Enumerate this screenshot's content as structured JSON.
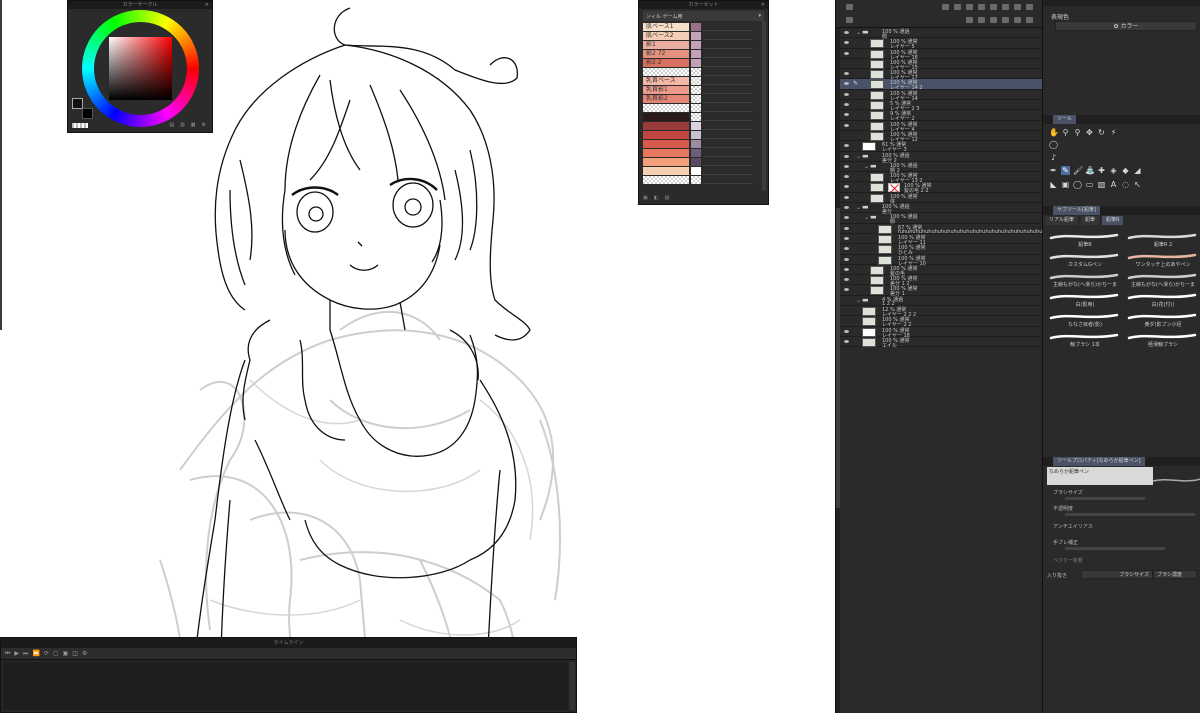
{
  "color_wheel_panel": {
    "title": "カラーサークル",
    "main_color": "#111111",
    "sub_color": "#000000",
    "hue_color": "#ff0000"
  },
  "color_set_panel": {
    "title": "カラーセット",
    "set_name": "ンィル ゲーム用",
    "entries": [
      {
        "label": "肌ベース1",
        "c1": "#f6dfc9",
        "c2": "#9b6f86"
      },
      {
        "label": "肌ベース2",
        "c1": "#f3cdb5",
        "c2": "#c3a2b8"
      },
      {
        "label": "影1",
        "c1": "#ecaea0",
        "c2": "#c3a2b8"
      },
      {
        "label": "影2 72",
        "c1": "#e4917e",
        "c2": "#c3a2b8"
      },
      {
        "label": "影2 2",
        "c1": "#d87060",
        "c2": "#c3a2b8"
      },
      {
        "label": "",
        "c1": "checker",
        "c2": "checker"
      },
      {
        "label": "乳首ベース",
        "c1": "#f2b7a5",
        "c2": "checker"
      },
      {
        "label": "乳首影1",
        "c1": "#ed9a8c",
        "c2": "checker"
      },
      {
        "label": "乳首影2",
        "c1": "#e58576",
        "c2": "checker"
      },
      {
        "label": "",
        "c1": "checker",
        "c2": "checker"
      },
      {
        "label": "",
        "c1": "#2a1a1a",
        "c2": "checker"
      },
      {
        "label": "",
        "c1": "#9a3a3a",
        "c2": "#d9d3dd"
      },
      {
        "label": "",
        "c1": "#c0463f",
        "c2": "#c8c1ce"
      },
      {
        "label": "",
        "c1": "#d85a4f",
        "c2": "#9c8aa3"
      },
      {
        "label": "",
        "c1": "#e6785f",
        "c2": "#6f5d7c"
      },
      {
        "label": "",
        "c1": "#f1a07a",
        "c2": "#5a4b63"
      },
      {
        "label": "",
        "c1": "#f6d0b0",
        "c2": "#ffffff"
      },
      {
        "label": "",
        "c1": "checker",
        "c2": "checker"
      }
    ]
  },
  "timeline_panel": {
    "title": "タイムライン"
  },
  "layer_panel": {
    "layers": [
      {
        "indent": 0,
        "kind": "folder",
        "eye": true,
        "line1": "100 % 通過",
        "line2": "顔"
      },
      {
        "indent": 1,
        "kind": "img",
        "eye": true,
        "line1": "100 % 通常",
        "line2": "レイヤー 5"
      },
      {
        "indent": 1,
        "kind": "thumb",
        "eye": true,
        "line1": "100 % 通常",
        "line2": "レイヤー 16"
      },
      {
        "indent": 1,
        "kind": "thumb",
        "eye": false,
        "line1": "100 % 通常",
        "line2": "レイヤー 15"
      },
      {
        "indent": 1,
        "kind": "thumb",
        "eye": true,
        "line1": "100 % 通常",
        "line2": "レイヤー 17"
      },
      {
        "indent": 1,
        "kind": "thumb",
        "eye": true,
        "pen": true,
        "selected": true,
        "line1": "100 % 通常",
        "line2": "レイヤー 14 2"
      },
      {
        "indent": 1,
        "kind": "thumb",
        "eye": true,
        "line1": "100 % 通常",
        "line2": "レイヤー 14"
      },
      {
        "indent": 1,
        "kind": "thumb",
        "eye": true,
        "line1": "5 % 通常",
        "line2": "レイヤー 2 3"
      },
      {
        "indent": 1,
        "kind": "thumb",
        "eye": true,
        "line1": "9 % 通常",
        "line2": "レイヤー 2"
      },
      {
        "indent": 1,
        "kind": "thumb",
        "eye": true,
        "line1": "100 % 通常",
        "line2": "レイヤー 4"
      },
      {
        "indent": 1,
        "kind": "thumb",
        "eye": false,
        "line1": "100 % 通常",
        "line2": "レイヤー 12"
      },
      {
        "indent": 0,
        "kind": "white",
        "eye": true,
        "line1": "61 % 通常",
        "line2": "レイヤー 3"
      },
      {
        "indent": 0,
        "kind": "folder",
        "eye": true,
        "line1": "100 % 通過",
        "line2": "差分 2"
      },
      {
        "indent": 1,
        "kind": "folder",
        "eye": true,
        "line1": "100 % 通過",
        "line2": "顔 2"
      },
      {
        "indent": 1,
        "kind": "thumb",
        "eye": true,
        "line1": "100 % 通常",
        "line2": "レイヤー 13 2"
      },
      {
        "indent": 1,
        "kind": "thumb",
        "eye": true,
        "redx": true,
        "line1": "100 % 通常",
        "line2": "髪の毛 2 2"
      },
      {
        "indent": 1,
        "kind": "thumb",
        "eye": true,
        "line1": "100 % 通常",
        "line2": "体"
      },
      {
        "indent": 0,
        "kind": "folder",
        "eye": true,
        "line1": "100 % 通過",
        "line2": "差分"
      },
      {
        "indent": 1,
        "kind": "folder",
        "eye": true,
        "line1": "100 % 通過",
        "line2": "顔"
      },
      {
        "indent": 2,
        "kind": "thumb",
        "eye": true,
        "line1": "67 % 通常",
        "line2": "fuhuhuhuhuhuhuhuhuhuhuhuhuhuhuhuhuhuhuhuhuhuhuhuhuhuhuhuhuhuhuhuhuhuhuhuhuhuhuhuhuhuhu"
      },
      {
        "indent": 2,
        "kind": "thumb",
        "eye": true,
        "line1": "100 % 通常",
        "line2": "レイヤー 11"
      },
      {
        "indent": 2,
        "kind": "thumb",
        "eye": true,
        "line1": "100 % 通常",
        "line2": "ひとみ"
      },
      {
        "indent": 2,
        "kind": "thumb",
        "eye": true,
        "line1": "100 % 通常",
        "line2": "レイヤー 10"
      },
      {
        "indent": 1,
        "kind": "thumb",
        "eye": true,
        "line1": "100 % 通常",
        "line2": "髪の毛"
      },
      {
        "indent": 1,
        "kind": "thumb",
        "eye": true,
        "line1": "100 % 通常",
        "line2": "差分 1 2"
      },
      {
        "indent": 1,
        "kind": "thumb",
        "eye": true,
        "line1": "100 % 通常",
        "line2": "差分 1"
      },
      {
        "indent": 0,
        "kind": "folder",
        "eye": false,
        "line1": "4 % 通過",
        "line2": "1 2 2"
      },
      {
        "indent": 0,
        "kind": "thumb",
        "eye": false,
        "line1": "12 % 通常",
        "line2": "レイヤー 2 2 2"
      },
      {
        "indent": 0,
        "kind": "thumb",
        "eye": false,
        "line1": "100 % 通常",
        "line2": "レイヤー 2 2"
      },
      {
        "indent": 0,
        "kind": "white",
        "eye": true,
        "line1": "100 % 通常",
        "line2": "レイヤー 18"
      },
      {
        "indent": 0,
        "kind": "thumb",
        "eye": true,
        "line1": "100 % 通常",
        "line2": "エイル"
      }
    ]
  },
  "right_panel": {
    "expression_label": "表現色",
    "expression_value": "カラー",
    "tool_tab": "ツール",
    "subtool_tab": "サブツール[鉛筆]",
    "subtool_groups": [
      "リアル鉛筆",
      "鉛筆",
      "鉛筆R"
    ],
    "brushes": [
      {
        "name": "鉛筆R",
        "color": "#e8e8e8"
      },
      {
        "name": "鉛筆R 2",
        "color": "#d8d8d8"
      },
      {
        "name": "カスタムGペン",
        "color": "#e0e0e0"
      },
      {
        "name": "ワンタッチ上のあやペン",
        "color": "#e8b5a0"
      },
      {
        "name": "主線もがな(ヘ滑ら)かちーま",
        "color": "#cccccc"
      },
      {
        "name": "主線もがな(ヘ滑ら)かちーま",
        "color": "#cccccc"
      },
      {
        "name": "白(影用)",
        "color": "#ffffff"
      },
      {
        "name": "白(花(付))",
        "color": "#ffffff"
      },
      {
        "name": "ななさ目者(影)",
        "color": "#ffffff"
      },
      {
        "name": "黄ダ(影ブン小径",
        "color": "#ffffff"
      },
      {
        "name": "鯨ブラシ 1本",
        "color": "#ffffff"
      },
      {
        "name": "極滑鯨ブラシ",
        "color": "#ffffff"
      }
    ],
    "tool_property_title": "ツールプロパティ[なめらか鉛筆ペン]",
    "property_preset": "なめらか鉛筆ペン",
    "props": [
      "ブラシサイズ",
      "不透明度",
      "アンチエイリアス",
      "手ブレ補正",
      "ベクター吸着"
    ],
    "pressure_label": "入り抜き",
    "pressure_btn1": "ブラシサイズ",
    "pressure_btn2": "ブラシ濃度"
  }
}
